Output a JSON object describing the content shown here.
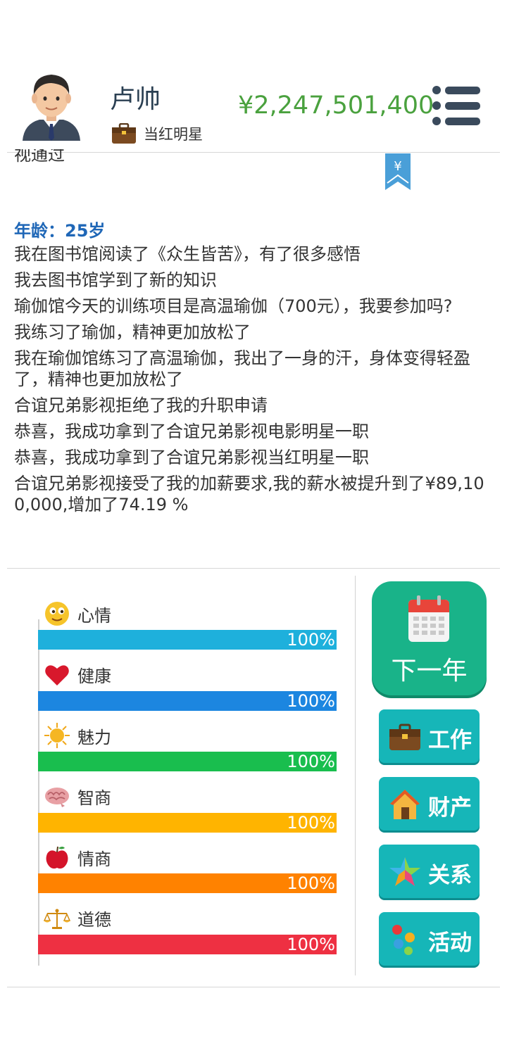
{
  "profile": {
    "name": "卢帅",
    "job": "当红明星",
    "money": "¥2,247,501,400"
  },
  "log": {
    "cut_line": "视通过",
    "age": "年龄：25岁",
    "lines": [
      "我在图书馆阅读了《众生皆苦》，有了很多感悟",
      "我去图书馆学到了新的知识",
      "瑜伽馆今天的训练项目是高温瑜伽（700元），我要参加吗?",
      "我练习了瑜伽，精神更加放松了",
      "我在瑜伽馆练习了高温瑜伽，我出了一身的汗，身体变得轻盈了，精神也更加放松了",
      "合谊兄弟影视拒绝了我的升职申请",
      "恭喜，我成功拿到了合谊兄弟影视电影明星一职",
      "恭喜，我成功拿到了合谊兄弟影视当红明星一职",
      "合谊兄弟影视接受了我的加薪要求,我的薪水被提升到了¥89,100,000,增加了74.19 %"
    ]
  },
  "stats": [
    {
      "label": "心情",
      "value": "100%",
      "level": 1.0,
      "color": "#1eb0dc",
      "icon": "smiley-icon"
    },
    {
      "label": "健康",
      "value": "100%",
      "level": 1.0,
      "color": "#1c86e0",
      "icon": "heart-icon"
    },
    {
      "label": "魅力",
      "value": "100%",
      "level": 1.0,
      "color": "#19be4e",
      "icon": "sun-icon"
    },
    {
      "label": "智商",
      "value": "100%",
      "level": 1.0,
      "color": "#ffb400",
      "icon": "brain-icon"
    },
    {
      "label": "情商",
      "value": "100%",
      "level": 1.0,
      "color": "#ff8200",
      "icon": "apple-icon"
    },
    {
      "label": "道德",
      "value": "100%",
      "level": 1.0,
      "color": "#ee3042",
      "icon": "scales-icon"
    }
  ],
  "buttons": {
    "next_year": "下一年",
    "work": "工作",
    "property": "财产",
    "relations": "关系",
    "activities": "活动"
  }
}
